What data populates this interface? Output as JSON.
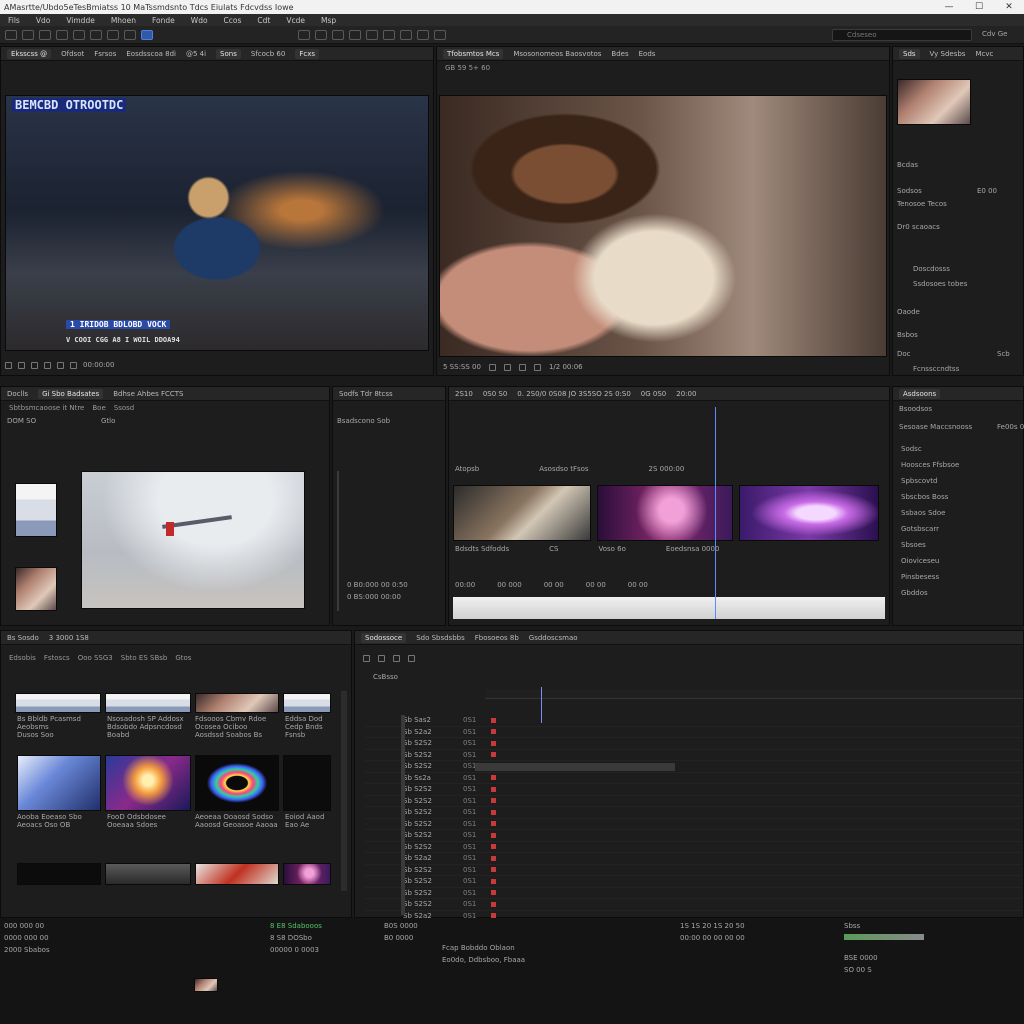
{
  "titlebar": {
    "title": "AMasrtte/Ubdo5eTesBmiatss   10    MaTssmdsnto    Tdcs    Eiulats    Fdcvdss    Iowe",
    "minimize": "—",
    "maximize": "☐",
    "close": "✕"
  },
  "menubar": [
    "Fils",
    "Vdo",
    "Vimdde",
    "Mhoen",
    "Fonde",
    "Wdo",
    "Ccos",
    "Cdt",
    "Vcde",
    "Msp"
  ],
  "toolbar": {
    "search_placeholder": "Cdseseo",
    "view_label": "Cdv Ge"
  },
  "source_viewer": {
    "tabs": [
      "Eksscss @",
      "Ofdsot",
      "Fsrsos",
      "Eosdsscoa 8di",
      "@5 4i",
      "Sons",
      "Sfcocb 60",
      "Fcxs"
    ],
    "overlay_top": "BEMCBD OTROOTDC",
    "overlay_bottom": "1 IRIDOB BDLOBD VOCK",
    "overlay_caption": "V COOI CGG A8 I WOIL DDOA94",
    "timecode": "00:00:00"
  },
  "program_viewer": {
    "tabs": [
      "Tfobsmtos Mcs",
      "Msosonomeos Baosvotos",
      "Bdes",
      "Eods"
    ],
    "sub": "GB 59 5+ 60",
    "timecode": "5 SS:SS 00",
    "footer": "1/2 00:06"
  },
  "right_top": {
    "tabs": [
      "Sds",
      "Vy Sdesbs",
      "Mcvc"
    ],
    "rows": [
      "Sodsos",
      "Tenosoe Tecos",
      "Dr0 scaoacs",
      "Oaode"
    ],
    "fields": [
      "Doscdosss",
      "Ssdosoes tobes",
      "Fcnssccndtss"
    ],
    "lbl_a": "Bcdas",
    "lbl_b": "Bsbos",
    "lbl_c": "Doc",
    "time_a": "E0 00",
    "time_b": "Scb"
  },
  "project_panel": {
    "tabs": [
      "Doclls",
      "Gi Sbo Badsates",
      "Bdhse Ahbes FCCTS",
      "Sodfs Tdr 8tcss",
      "Bsadscono Sob"
    ],
    "search": "Sbtbsmcaoose it  Ntre",
    "subbar": [
      "Boe",
      "Ssosd",
      "DOM SO"
    ],
    "timecode": "Gtlo"
  },
  "effects_panel": {
    "ruler": [
      "2S10",
      "0S0 S0",
      "0. 2S0/0 0S08 JO 3S5SO 2S 0:S0",
      "0G 0S0",
      "20:00",
      "0S 0G1A0",
      "NS00"
    ],
    "clips_top": [
      "Atopsb",
      "Asosdso tFsos",
      "2S 000:00"
    ],
    "clips_caption": [
      "Bdsdts Sdfodds",
      "CS",
      "Voso 6o",
      "Eoedsnsa 0000"
    ],
    "timecodes": [
      "0 B0:000 00 0:50",
      "0 BS:000 00:00"
    ],
    "bottom_ruler": [
      "00:00",
      "00 000",
      "00 00",
      "00 00",
      "00 00"
    ]
  },
  "right_mid": {
    "header": [
      "Asdsoons",
      "Bsoodsos"
    ],
    "items": [
      "Sodsc",
      "Hoosces Ffsbsoe",
      "Spbscovtd",
      "Sbscbos Boss",
      "Ssbaos Sdoe",
      "Gotsbscarr",
      "Sbsoes",
      "Oioviceseu",
      "Pinsbesess",
      "Gbddos"
    ],
    "search": "Sesoase Maccsnooss",
    "label": "Fe00s 0"
  },
  "bin_panel": {
    "tabs": [
      "Edsobis",
      "Fstoscs",
      "Ooo SSG3",
      "Sbto ES SBsb",
      "Gtos"
    ],
    "hdr": [
      "Bs Sosdo",
      "3 3000 1S8"
    ],
    "grid": [
      [
        "Bs Bbldb Pcasmsd",
        "Nsosadosh SP Addosx",
        "Fdsooos Cbmv Rdoe",
        "Eddsa Dod"
      ],
      [
        "Aeobsms",
        "Bdsobdo Adpsncdosd",
        "Ocosea Ociboo",
        "Cedp Bnds"
      ],
      [
        "Dusos Soo",
        "Boabd",
        "Aosdssd Soabos Bs",
        "Fsnsb"
      ],
      [
        "Aooba Eoeaso Sbo",
        "FooD Odsbdosee",
        "Aeoeaa Ooaosd Sodso",
        "Eoiod Aaod"
      ],
      [
        "Aeoacs Oso OB",
        "Ooeaaa Sdoes",
        "Aaoosd Geoasoe Aaoaa",
        "Eao Ae"
      ]
    ]
  },
  "timeline_panel": {
    "tabs": [
      "Sodossoce",
      "Sdo Sbsdsbbs",
      "Fbosoeos 8b",
      "Gsddoscsmao"
    ],
    "track_name": "CsBsso",
    "rows": [
      [
        "Sb Sas2",
        "0S1"
      ],
      [
        "Sb S2a2",
        "0S1"
      ],
      [
        "Sb S2S2",
        "0S1"
      ],
      [
        "Sb S2S2",
        "0S1"
      ],
      [
        "Sb S2S2",
        "0S1"
      ],
      [
        "Sb Ss2a",
        "0S1"
      ],
      [
        "Sb S2S2",
        "0S1"
      ],
      [
        "Sb S2S2",
        "0S1"
      ],
      [
        "Sb S2S2",
        "0S1"
      ],
      [
        "Sb S2S2",
        "0S1"
      ],
      [
        "Sb S2S2",
        "0S1"
      ],
      [
        "Sb S2S2",
        "0S1"
      ],
      [
        "Sb S2a2",
        "0S1"
      ],
      [
        "Sb S2S2",
        "0S1"
      ],
      [
        "Sb S2S2",
        "0S1"
      ],
      [
        "Sb S2S2",
        "0S1"
      ],
      [
        "Sb S2S2",
        "0S1"
      ],
      [
        "Sb S2a2",
        "0S1"
      ],
      [
        "Sb S2S2",
        "0S1"
      ],
      [
        "Sb S2S2",
        "0S1"
      ]
    ]
  },
  "bottom_bar": {
    "left": [
      "000 000 00",
      "0000 000 00",
      "2000 Sbabos"
    ],
    "mid": [
      "8 E8 Sdabooos",
      "8 S8 DOSbo",
      "00000 0 0003"
    ],
    "mid2": [
      "B0S 0000",
      "B0 0000"
    ],
    "mid3": [
      "Fcap Bobddo Oblaon",
      "Eo0do, Ddbsboo, Fbaaa"
    ],
    "right": [
      "1S 1S 20 1S 20 50",
      "00:00 00 00 00 00"
    ],
    "right2": [
      "Sbss",
      "ASB SEC"
    ],
    "right3": [
      "BSE 0000",
      "SO 00 S"
    ]
  }
}
